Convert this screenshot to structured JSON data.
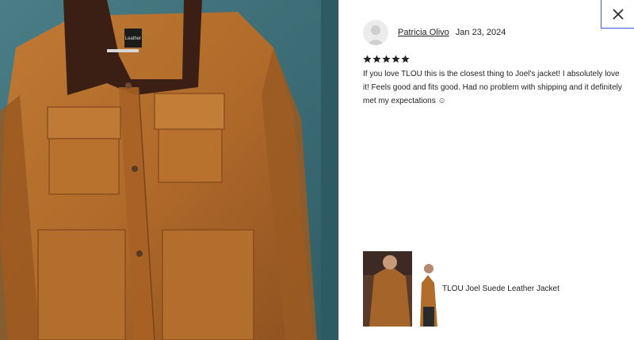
{
  "photo": {
    "alt_icon": "jacket-photo",
    "colors": {
      "wall": "#3f7179",
      "suede": "#b06a2a",
      "collar": "#3b1f15"
    },
    "tag_text": "Leather"
  },
  "review": {
    "reviewer_name": "Patricia Olivo",
    "date": "Jan 23, 2024",
    "rating": 5,
    "rating_max": 5,
    "text": "If you love TLOU this is the closest thing to Joel's jacket! I absolutely love it! Feels good and fits good. Had no problem with shipping and it definitely met my expectations ☺"
  },
  "product": {
    "name": "TLOU Joel Suede Leather Jacket"
  },
  "controls": {
    "close_icon": "close-icon"
  }
}
